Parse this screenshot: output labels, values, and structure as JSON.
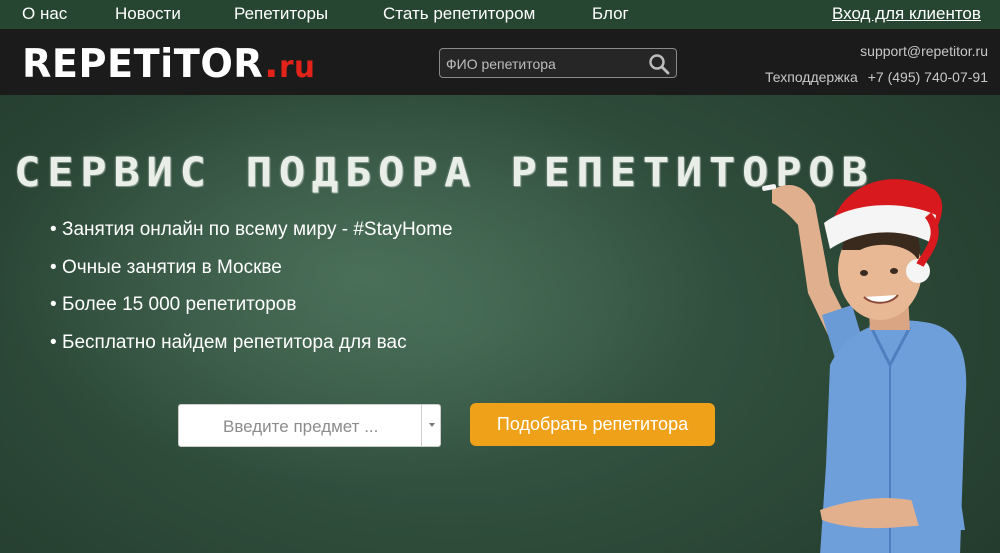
{
  "topnav": {
    "items": [
      "О нас",
      "Новости",
      "Репетиторы",
      "Стать репетитором",
      "Блог"
    ],
    "login": "Вход для клиентов"
  },
  "header": {
    "logo_main": "REPETiTOR",
    "logo_dot": ".",
    "logo_ru": "ru",
    "search_placeholder": "ФИО репетитора",
    "support_email": "support@repetitor.ru",
    "support_label": "Техподдержка",
    "support_phone": "+7 (495) 740-07-91"
  },
  "hero": {
    "title": "СЕРВИС ПОДБОРА РЕПЕТИТОРОВ",
    "features": [
      "Занятия онлайн по всему миру - #StayHome",
      "Очные занятия в Москве",
      "Более 15 000 репетиторов",
      "Бесплатно найдем репетитора для вас"
    ],
    "subject_placeholder": "Введите предмет ...",
    "button_label": "Подобрать репетитора"
  },
  "colors": {
    "topnav_bg": "#264632",
    "header_bg": "#1b1b1b",
    "board_green": "#2e4a3a",
    "logo_red": "#e2231a",
    "button_orange": "#f0a11a"
  },
  "icons": {
    "search": "search-icon",
    "dropdown": "caret-down-icon"
  }
}
